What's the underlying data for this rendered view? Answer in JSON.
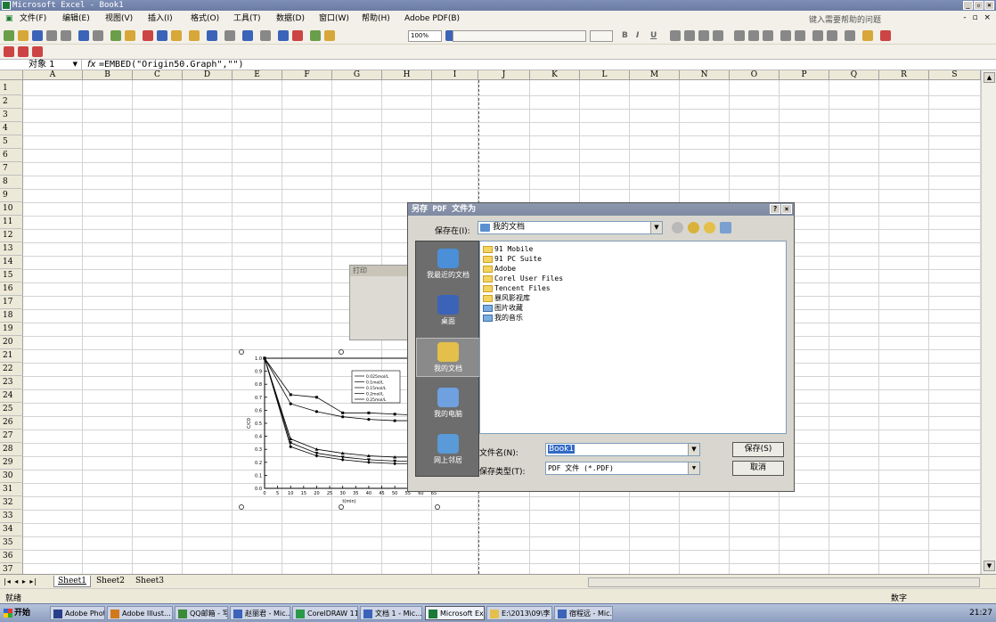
{
  "window": {
    "title": "Microsoft Excel - Book1"
  },
  "menu": {
    "items": [
      "文件(F)",
      "编辑(E)",
      "视图(V)",
      "插入(I)",
      "格式(O)",
      "工具(T)",
      "数据(D)",
      "窗口(W)",
      "帮助(H)",
      "Adobe PDF(B)"
    ],
    "help_placeholder": "键入需要帮助的问题"
  },
  "toolbar": {
    "zoom": "100%",
    "format_buttons": [
      "B",
      "I",
      "U"
    ]
  },
  "formula_bar": {
    "name_box": "对象 1",
    "fx": "fx",
    "formula": "=EMBED(\"Origin50.Graph\",\"\")"
  },
  "columns": [
    "A",
    "B",
    "C",
    "D",
    "E",
    "F",
    "G",
    "H",
    "I",
    "J",
    "K",
    "L",
    "M",
    "N",
    "O",
    "P",
    "Q",
    "R",
    "S"
  ],
  "rows": [
    "1",
    "2",
    "3",
    "4",
    "5",
    "6",
    "7",
    "8",
    "9",
    "10",
    "11",
    "12",
    "13",
    "14",
    "15",
    "16",
    "17",
    "18",
    "19",
    "20",
    "21",
    "22",
    "23",
    "24",
    "25",
    "26",
    "27",
    "28",
    "29",
    "30",
    "31",
    "32",
    "33",
    "34",
    "35",
    "36",
    "37"
  ],
  "sheets": [
    "Sheet1",
    "Sheet2",
    "Sheet3"
  ],
  "active_sheet": "Sheet1",
  "status": {
    "left": "就绪",
    "right": "数字"
  },
  "print_box": {
    "title": "打印"
  },
  "dialog": {
    "title": "另存 PDF 文件为",
    "save_in_label": "保存在(I):",
    "save_in_value": "我的文档",
    "places": [
      "我最近的文档",
      "桌面",
      "我的文档",
      "我的电脑",
      "网上邻居"
    ],
    "active_place": "我的文档",
    "files": [
      "91 Mobile",
      "91 PC Suite",
      "Adobe",
      "Corel User Files",
      "Tencent Files",
      "暴风影视库",
      "图片收藏",
      "我的音乐"
    ],
    "filename_label": "文件名(N):",
    "filename_value": "Book1",
    "filetype_label": "保存类型(T):",
    "filetype_value": "PDF 文件 (*.PDF)",
    "save_button": "保存(S)",
    "cancel_button": "取消"
  },
  "taskbar": {
    "start": "开始",
    "tasks": [
      "Adobe Photos...",
      "Adobe Illust...",
      "QQ邮箱 - 写...",
      "赵丽君 - Mic...",
      "CorelDRAW 11...",
      "文档 1 - Mic...",
      "Microsoft Ex...",
      "E:\\2013\\09\\李",
      "宿程远 - Mic..."
    ],
    "active_task": "Microsoft Ex...",
    "clock": "21:27"
  },
  "chart_data": {
    "type": "line",
    "xlabel": "t(min)",
    "ylabel": "C/C0",
    "xlim": [
      0,
      65
    ],
    "ylim": [
      0,
      1.0
    ],
    "x": [
      0,
      10,
      20,
      30,
      40,
      50,
      60
    ],
    "x_ticks": [
      "0",
      "5",
      "10",
      "15",
      "20",
      "25",
      "30",
      "35",
      "40",
      "45",
      "50",
      "55",
      "60",
      "65"
    ],
    "y_ticks": [
      "0.0",
      "0.1",
      "0.2",
      "0.3",
      "0.4",
      "0.5",
      "0.6",
      "0.7",
      "0.8",
      "0.9",
      "1.0"
    ],
    "legend_position": "top-right",
    "series": [
      {
        "values": [
          1.0,
          0.72,
          0.7,
          0.58,
          0.58,
          0.57,
          0.56
        ]
      },
      {
        "values": [
          1.0,
          0.65,
          0.59,
          0.55,
          0.53,
          0.52,
          0.52
        ]
      },
      {
        "values": [
          1.0,
          0.38,
          0.3,
          0.27,
          0.25,
          0.24,
          0.24
        ]
      },
      {
        "values": [
          1.0,
          0.35,
          0.27,
          0.24,
          0.22,
          0.21,
          0.21
        ]
      },
      {
        "values": [
          1.0,
          0.32,
          0.25,
          0.22,
          0.2,
          0.19,
          0.19
        ]
      }
    ],
    "legend_entries": [
      "0.025mol/L",
      "0.1mol/L",
      "0.15mol/L",
      "0.2mol/L",
      "0.25mol/L"
    ]
  }
}
